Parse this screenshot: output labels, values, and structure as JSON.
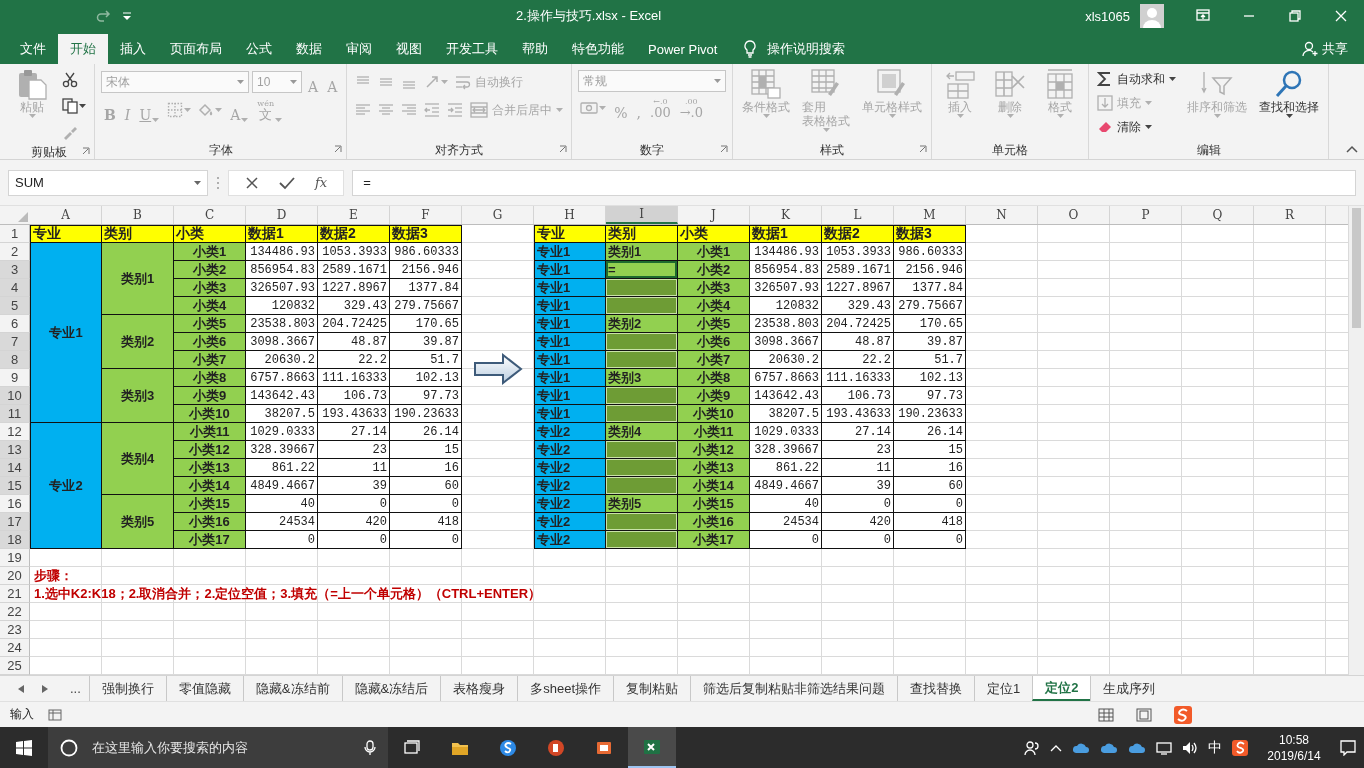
{
  "title_bar": {
    "title": "2.操作与技巧.xlsx  -  Excel",
    "user": "xls1065"
  },
  "ribbon_tabs": [
    {
      "label": "文件",
      "selected": false
    },
    {
      "label": "开始",
      "selected": true
    },
    {
      "label": "插入",
      "selected": false
    },
    {
      "label": "页面布局",
      "selected": false
    },
    {
      "label": "公式",
      "selected": false
    },
    {
      "label": "数据",
      "selected": false
    },
    {
      "label": "审阅",
      "selected": false
    },
    {
      "label": "视图",
      "selected": false
    },
    {
      "label": "开发工具",
      "selected": false
    },
    {
      "label": "帮助",
      "selected": false
    },
    {
      "label": "特色功能",
      "selected": false
    },
    {
      "label": "Power Pivot",
      "selected": false
    }
  ],
  "tell_me": "操作说明搜索",
  "share": "共享",
  "ribbon_groups": [
    {
      "label": "剪贴板",
      "launcher": true,
      "stacks": [
        [
          {
            "kind": "large",
            "label": "粘贴",
            "disabled": true,
            "dropdown": true
          }
        ],
        [
          {
            "kind": "icon",
            "disabled": false,
            "dropdown": false
          },
          {
            "kind": "icon",
            "disabled": false,
            "dropdown": true
          },
          {
            "kind": "icon",
            "disabled": true,
            "dropdown": false
          }
        ]
      ]
    },
    {
      "label": "字体",
      "launcher": true,
      "strips": [
        [
          {
            "kind": "field",
            "value": "宋体",
            "disabled": true
          },
          {
            "kind": "field",
            "value": "10",
            "disabled": true
          },
          {
            "kind": "glyph",
            "text": "A",
            "disabled": true,
            "dropdown": false
          },
          {
            "kind": "glyph",
            "text": "A",
            "disabled": true,
            "dropdown": false
          }
        ],
        [
          {
            "kind": "glyph",
            "text": "B",
            "disabled": true,
            "dropdown": false
          },
          {
            "kind": "glyph",
            "text": "I",
            "disabled": true,
            "dropdown": false
          },
          {
            "kind": "glyph",
            "text": "U",
            "disabled": true,
            "dropdown": true
          },
          {
            "kind": "icon",
            "disabled": true,
            "dropdown": true
          },
          {
            "kind": "icon",
            "disabled": true,
            "dropdown": true
          },
          {
            "kind": "glyph",
            "text": "A",
            "disabled": true,
            "dropdown": true
          },
          {
            "kind": "glyph",
            "text": "文",
            "ruby": "wén",
            "disabled": true,
            "dropdown": true
          }
        ]
      ]
    },
    {
      "label": "对齐方式",
      "launcher": true,
      "strips": [
        [
          {
            "kind": "icon",
            "disabled": true,
            "dropdown": false
          },
          {
            "kind": "icon",
            "disabled": true,
            "dropdown": false
          },
          {
            "kind": "icon",
            "disabled": true,
            "dropdown": false
          },
          {
            "kind": "icon",
            "disabled": true,
            "dropdown": true
          },
          {
            "kind": "small",
            "label": "自动换行",
            "disabled": true,
            "dropdown": false
          }
        ],
        [
          {
            "kind": "icon",
            "disabled": true,
            "dropdown": false
          },
          {
            "kind": "icon",
            "disabled": true,
            "dropdown": false
          },
          {
            "kind": "icon",
            "disabled": true,
            "dropdown": false
          },
          {
            "kind": "icon",
            "disabled": true,
            "dropdown": false
          },
          {
            "kind": "icon",
            "disabled": true,
            "dropdown": false
          },
          {
            "kind": "small",
            "label": "合并后居中",
            "disabled": true,
            "dropdown": true
          }
        ]
      ]
    },
    {
      "label": "数字",
      "launcher": true,
      "strips": [
        [
          {
            "kind": "field",
            "value": "常规",
            "disabled": true
          }
        ],
        [
          {
            "kind": "icon",
            "disabled": true,
            "dropdown": true
          },
          {
            "kind": "glyph",
            "text": "%",
            "disabled": true,
            "dropdown": false
          },
          {
            "kind": "glyph",
            "text": ",",
            "disabled": true,
            "dropdown": false
          },
          {
            "kind": "glyph",
            "text": ".00",
            "ruby": "←.0",
            "disabled": true,
            "dropdown": false
          },
          {
            "kind": "glyph",
            "text": "→.0",
            "ruby": ".00",
            "disabled": true,
            "dropdown": false
          }
        ]
      ]
    },
    {
      "label": "样式",
      "launcher": true,
      "stacks": [
        [
          {
            "kind": "large",
            "label": "条件格式",
            "disabled": true,
            "dropdown": true
          }
        ],
        [
          {
            "kind": "large",
            "label": "套用",
            "label_2": "表格格式",
            "disabled": true,
            "dropdown": true
          }
        ],
        [
          {
            "kind": "large",
            "label": "单元格样式",
            "disabled": true,
            "dropdown": true
          }
        ]
      ]
    },
    {
      "label": "单元格",
      "launcher": false,
      "stacks": [
        [
          {
            "kind": "large",
            "label": "插入",
            "disabled": true,
            "dropdown": true
          }
        ],
        [
          {
            "kind": "large",
            "label": "删除",
            "disabled": true,
            "dropdown": true
          }
        ],
        [
          {
            "kind": "large",
            "label": "格式",
            "disabled": true,
            "dropdown": true
          }
        ]
      ]
    },
    {
      "label": "编辑",
      "launcher": false,
      "stacks": [
        [
          {
            "kind": "small",
            "label": "自动求和",
            "disabled": false,
            "dropdown": true
          },
          {
            "kind": "small",
            "label": "填充",
            "disabled": true,
            "dropdown": true
          },
          {
            "kind": "small",
            "label": "清除",
            "disabled": false,
            "dropdown": true
          }
        ],
        [
          {
            "kind": "large",
            "label": "排序和筛选",
            "disabled": true,
            "dropdown": true
          }
        ],
        [
          {
            "kind": "large",
            "label": "查找和选择",
            "disabled": false,
            "dropdown": true
          }
        ]
      ]
    }
  ],
  "formula_bar": {
    "name_box": "SUM",
    "function_button": "fx",
    "formula": "="
  },
  "columns": [
    {
      "label": "A",
      "selected": false
    },
    {
      "label": "B",
      "selected": false
    },
    {
      "label": "C",
      "selected": false
    },
    {
      "label": "D",
      "selected": false
    },
    {
      "label": "E",
      "selected": false
    },
    {
      "label": "F",
      "selected": false
    },
    {
      "label": "G",
      "selected": false
    },
    {
      "label": "H",
      "selected": false
    },
    {
      "label": "I",
      "selected": true
    },
    {
      "label": "J",
      "selected": false
    },
    {
      "label": "K",
      "selected": false
    },
    {
      "label": "L",
      "selected": false
    },
    {
      "label": "M",
      "selected": false
    },
    {
      "label": "N",
      "selected": false
    },
    {
      "label": "O",
      "selected": false
    },
    {
      "label": "P",
      "selected": false
    },
    {
      "label": "Q",
      "selected": false
    },
    {
      "label": "R",
      "selected": false
    }
  ],
  "rows": [
    {
      "label": "1",
      "selected": false
    },
    {
      "label": "2",
      "selected": false
    },
    {
      "label": "3",
      "selected": true
    },
    {
      "label": "4",
      "selected": true
    },
    {
      "label": "5",
      "selected": true
    },
    {
      "label": "6",
      "selected": false
    },
    {
      "label": "7",
      "selected": true
    },
    {
      "label": "8",
      "selected": true
    },
    {
      "label": "9",
      "selected": false
    },
    {
      "label": "10",
      "selected": true
    },
    {
      "label": "11",
      "selected": true
    },
    {
      "label": "12",
      "selected": false
    },
    {
      "label": "13",
      "selected": true
    },
    {
      "label": "14",
      "selected": true
    },
    {
      "label": "15",
      "selected": true
    },
    {
      "label": "16",
      "selected": false
    },
    {
      "label": "17",
      "selected": true
    },
    {
      "label": "18",
      "selected": true
    },
    {
      "label": "19",
      "selected": false
    },
    {
      "label": "20",
      "selected": false
    },
    {
      "label": "21",
      "selected": false
    },
    {
      "label": "22",
      "selected": false
    },
    {
      "label": "23",
      "selected": false
    },
    {
      "label": "24",
      "selected": false
    },
    {
      "label": "25",
      "selected": false
    }
  ],
  "left_table": {
    "columns": [
      "专业",
      "类别",
      "小类",
      "数据1",
      "数据2",
      "数据3"
    ],
    "majors": [
      {
        "text": "专业1",
        "categories": [
          {
            "text": "类别1",
            "items": [
              [
                "小类1",
                "134486.93",
                "1053.3933",
                "986.60333"
              ],
              [
                "小类2",
                "856954.83",
                "2589.1671",
                "2156.946"
              ],
              [
                "小类3",
                "326507.93",
                "1227.8967",
                "1377.84"
              ],
              [
                "小类4",
                "120832",
                "329.43",
                "279.75667"
              ]
            ]
          },
          {
            "text": "类别2",
            "items": [
              [
                "小类5",
                "23538.803",
                "204.72425",
                "170.65"
              ],
              [
                "小类6",
                "3098.3667",
                "48.87",
                "39.87"
              ],
              [
                "小类7",
                "20630.2",
                "22.2",
                "51.7"
              ]
            ]
          },
          {
            "text": "类别3",
            "items": [
              [
                "小类8",
                "6757.8663",
                "111.16333",
                "102.13"
              ],
              [
                "小类9",
                "143642.43",
                "106.73",
                "97.73"
              ],
              [
                "小类10",
                "38207.5",
                "193.43633",
                "190.23633"
              ]
            ]
          }
        ]
      },
      {
        "text": "专业2",
        "categories": [
          {
            "text": "类别4",
            "items": [
              [
                "小类11",
                "1029.0333",
                "27.14",
                "26.14"
              ],
              [
                "小类12",
                "328.39667",
                "23",
                "15"
              ],
              [
                "小类13",
                "861.22",
                "11",
                "16"
              ],
              [
                "小类14",
                "4849.4667",
                "39",
                "60"
              ]
            ]
          },
          {
            "text": "类别5",
            "items": [
              [
                "小类15",
                "40",
                "0",
                "0"
              ],
              [
                "小类16",
                "24534",
                "420",
                "418"
              ],
              [
                "小类17",
                "0",
                "0",
                "0"
              ]
            ]
          }
        ]
      }
    ]
  },
  "right_table": {
    "columns": [
      "专业",
      "类别",
      "小类",
      "数据1",
      "数据2",
      "数据3"
    ],
    "rows": [
      {
        "major": "专业1",
        "category": "类别1",
        "category_selected": false,
        "category_active": false,
        "values": [
          "小类1",
          "134486.93",
          "1053.3933",
          "986.60333"
        ]
      },
      {
        "major": "专业1",
        "category": "=",
        "category_selected": true,
        "category_active": true,
        "values": [
          "小类2",
          "856954.83",
          "2589.1671",
          "2156.946"
        ]
      },
      {
        "major": "专业1",
        "category_selected": true,
        "category_active": false,
        "values": [
          "小类3",
          "326507.93",
          "1227.8967",
          "1377.84"
        ]
      },
      {
        "major": "专业1",
        "category_selected": true,
        "category_active": false,
        "values": [
          "小类4",
          "120832",
          "329.43",
          "279.75667"
        ]
      },
      {
        "major": "专业1",
        "category": "类别2",
        "category_selected": false,
        "category_active": false,
        "values": [
          "小类5",
          "23538.803",
          "204.72425",
          "170.65"
        ]
      },
      {
        "major": "专业1",
        "category_selected": true,
        "category_active": false,
        "values": [
          "小类6",
          "3098.3667",
          "48.87",
          "39.87"
        ]
      },
      {
        "major": "专业1",
        "category_selected": true,
        "category_active": false,
        "values": [
          "小类7",
          "20630.2",
          "22.2",
          "51.7"
        ]
      },
      {
        "major": "专业1",
        "category": "类别3",
        "category_selected": false,
        "category_active": false,
        "values": [
          "小类8",
          "6757.8663",
          "111.16333",
          "102.13"
        ]
      },
      {
        "major": "专业1",
        "category_selected": true,
        "category_active": false,
        "values": [
          "小类9",
          "143642.43",
          "106.73",
          "97.73"
        ]
      },
      {
        "major": "专业1",
        "category_selected": true,
        "category_active": false,
        "values": [
          "小类10",
          "38207.5",
          "193.43633",
          "190.23633"
        ]
      },
      {
        "major": "专业2",
        "category": "类别4",
        "category_selected": false,
        "category_active": false,
        "values": [
          "小类11",
          "1029.0333",
          "27.14",
          "26.14"
        ]
      },
      {
        "major": "专业2",
        "category_selected": true,
        "category_active": false,
        "values": [
          "小类12",
          "328.39667",
          "23",
          "15"
        ]
      },
      {
        "major": "专业2",
        "category_selected": true,
        "category_active": false,
        "values": [
          "小类13",
          "861.22",
          "11",
          "16"
        ]
      },
      {
        "major": "专业2",
        "category_selected": true,
        "category_active": false,
        "values": [
          "小类14",
          "4849.4667",
          "39",
          "60"
        ]
      },
      {
        "major": "专业2",
        "category": "类别5",
        "category_selected": false,
        "category_active": false,
        "values": [
          "小类15",
          "40",
          "0",
          "0"
        ]
      },
      {
        "major": "专业2",
        "category_selected": true,
        "category_active": false,
        "values": [
          "小类16",
          "24534",
          "420",
          "418"
        ]
      },
      {
        "major": "专业2",
        "category_selected": true,
        "category_active": false,
        "values": [
          "小类17",
          "0",
          "0",
          "0"
        ]
      }
    ]
  },
  "notes": [
    "步骤：",
    "1.选中K2:K18；2.取消合并；2.定位空值；3.填充（=上一个单元格）（CTRL+ENTER）"
  ],
  "sheet_tabs": [
    {
      "label": "强制换行",
      "selected": false
    },
    {
      "label": "零值隐藏",
      "selected": false
    },
    {
      "label": "隐藏&冻结前",
      "selected": false
    },
    {
      "label": "隐藏&冻结后",
      "selected": false
    },
    {
      "label": "表格瘦身",
      "selected": false
    },
    {
      "label": "多sheet操作",
      "selected": false
    },
    {
      "label": "复制粘贴",
      "selected": false
    },
    {
      "label": "筛选后复制粘贴非筛选结果问题",
      "selected": false
    },
    {
      "label": "查找替换",
      "selected": false
    },
    {
      "label": "定位1",
      "selected": false
    },
    {
      "label": "定位2",
      "selected": true
    },
    {
      "label": "生成序列",
      "selected": false
    }
  ],
  "sheet_tabs_more": "...",
  "status_bar": {
    "mode": "输入"
  },
  "taskbar": {
    "placeholder": "在这里输入你要搜索的内容",
    "ime": "中",
    "time": "10:58",
    "date": "2019/6/14"
  }
}
